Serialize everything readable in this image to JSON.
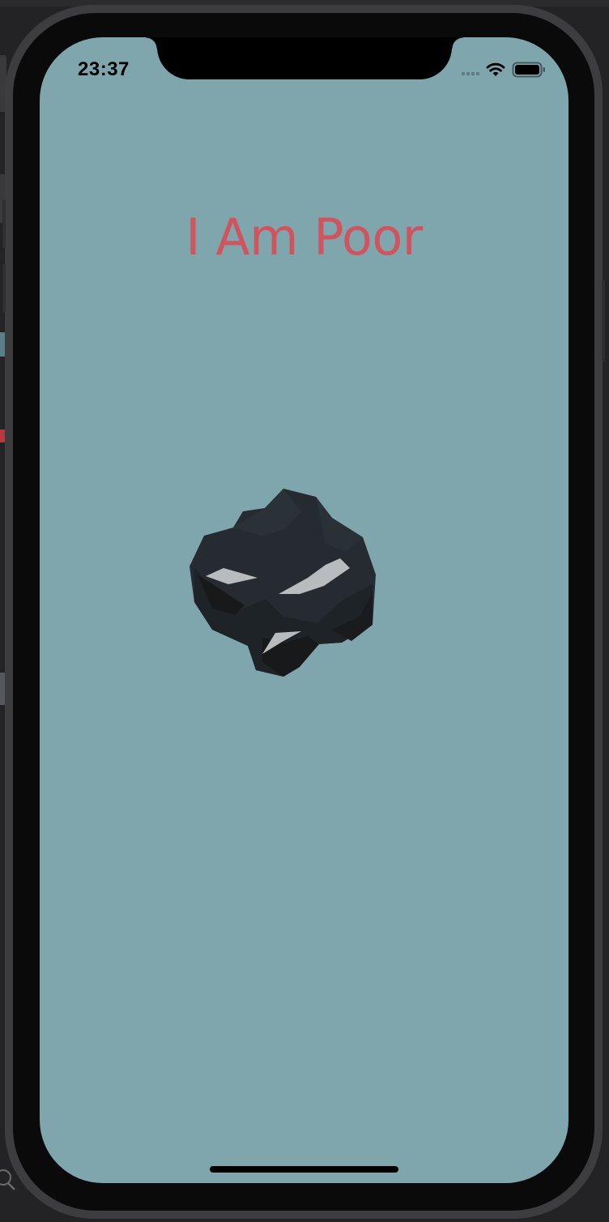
{
  "status_bar": {
    "time": "23:37",
    "signal_icon": "cellular-signal-icon",
    "wifi_icon": "wifi-icon",
    "battery_icon": "battery-icon"
  },
  "app": {
    "title": "I Am Poor",
    "image": "coal-rock-image",
    "background_color": "#7fa5ad",
    "title_color": "#d0545e"
  },
  "desktop": {
    "zoom_icon": "magnifier-icon"
  }
}
